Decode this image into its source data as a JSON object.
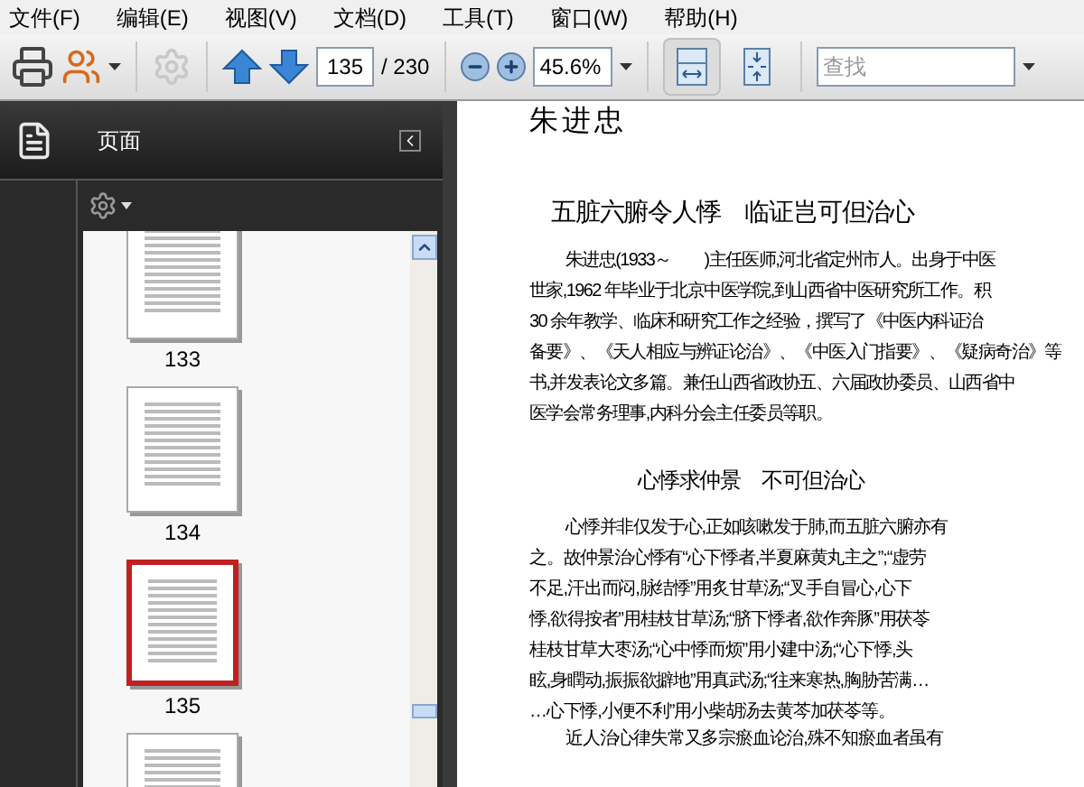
{
  "menu": [
    {
      "label": "文件(F)"
    },
    {
      "label": "编辑(E)"
    },
    {
      "label": "视图(V)"
    },
    {
      "label": "文档(D)"
    },
    {
      "label": "工具(T)"
    },
    {
      "label": "窗口(W)"
    },
    {
      "label": "帮助(H)"
    }
  ],
  "toolbar": {
    "page_number": "135",
    "page_total": "/ 230",
    "zoom": "45.6%",
    "search_placeholder": "查找",
    "view_modes": [
      {
        "kind": "fit-width",
        "selected": true
      },
      {
        "kind": "fit-page",
        "selected": false
      }
    ]
  },
  "panel": {
    "title": "页面",
    "thumbnails": [
      {
        "label": "133",
        "selected": false
      },
      {
        "label": "134",
        "selected": false
      },
      {
        "label": "135",
        "selected": true
      },
      {
        "selected": false
      }
    ]
  },
  "document": {
    "author": "朱进忠",
    "heading": "五脏六腑令人悸　临证岂可但治心",
    "bio": [
      "朱进忠(1933～　　)主任医师,河北省定州市人。出身于中医",
      "世家,1962 年毕业于北京中医学院,到山西省中医研究所工作。积",
      "30 余年教学、临床和研究工作之经验，撰写了《中医内科证治",
      "备要》、《天人相应与辨证论治》、《中医入门指要》、《疑病奇治》等",
      "书,并发表论文多篇。兼任山西省政协五、六届政协委员、山西省中",
      "医学会常务理事,内科分会主任委员等职。"
    ],
    "subheading": "心悸求仲景　不可但治心",
    "body": [
      "心悸并非仅发于心,正如咳嗽发于肺,而五脏六腑亦有",
      "之。故仲景治心悸有“心下悸者,半夏麻黄丸主之”;“虚劳",
      "不足,汗出而闷,脉结悸”用炙甘草汤;“叉手自冒心,心下",
      "悸,欲得按者”用桂枝甘草汤;“脐下悸者,欲作奔豚”用茯苓",
      "桂枝甘草大枣汤;“心中悸而烦”用小建中汤;“心下悸,头",
      "眩,身瞤动,振振欲擗地”用真武汤;“往来寒热,胸胁苦满…",
      "…心下悸,小便不利”用小柴胡汤去黄芩加茯苓等。"
    ],
    "last_line": "近人治心律失常又多宗瘀血论治,殊不知瘀血者虽有"
  }
}
